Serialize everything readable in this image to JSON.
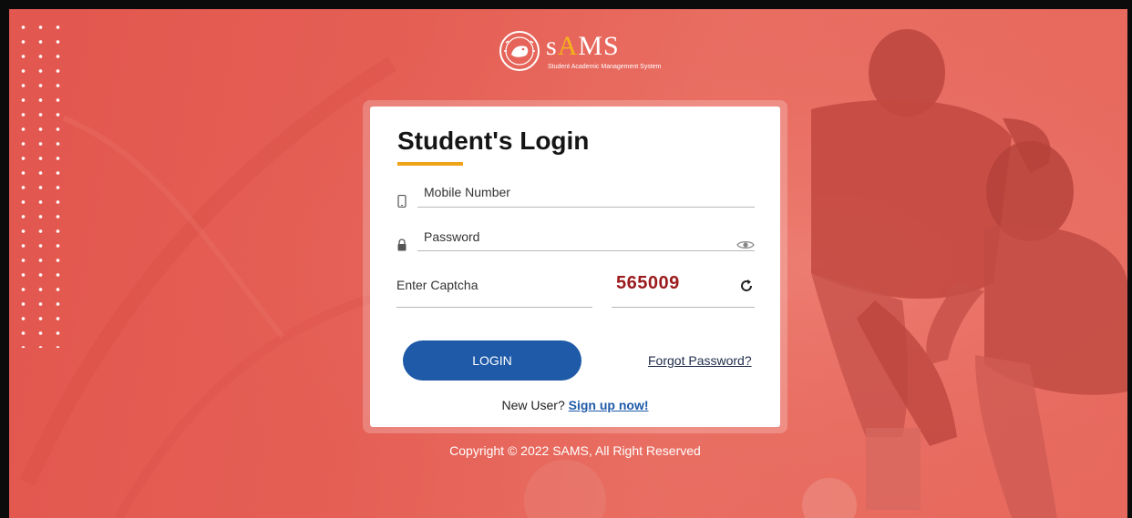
{
  "brand": {
    "logo_title_pre": "s",
    "logo_title_accent": "A",
    "logo_title_post": "MS",
    "logo_subtitle": "Student Academic Management System"
  },
  "login": {
    "title": "Student's Login",
    "mobile_label": "Mobile Number",
    "password_label": "Password",
    "captcha_label": "Enter Captcha",
    "captcha_code": "565009",
    "login_button": "LOGIN",
    "forgot_password": "Forgot Password?",
    "new_user_text": "New User?",
    "signup_link": "Sign up now!"
  },
  "footer": {
    "copyright": "Copyright © 2022 SAMS, All Right Reserved"
  },
  "colors": {
    "background": "#e55f55",
    "accent": "#eea318",
    "button": "#1e5aa8",
    "captcha": "#9b1b1d"
  },
  "icons": {
    "mobile": "mobile-phone-icon",
    "password": "lock-icon",
    "show_password": "eye-icon",
    "refresh_captcha": "refresh-icon"
  }
}
